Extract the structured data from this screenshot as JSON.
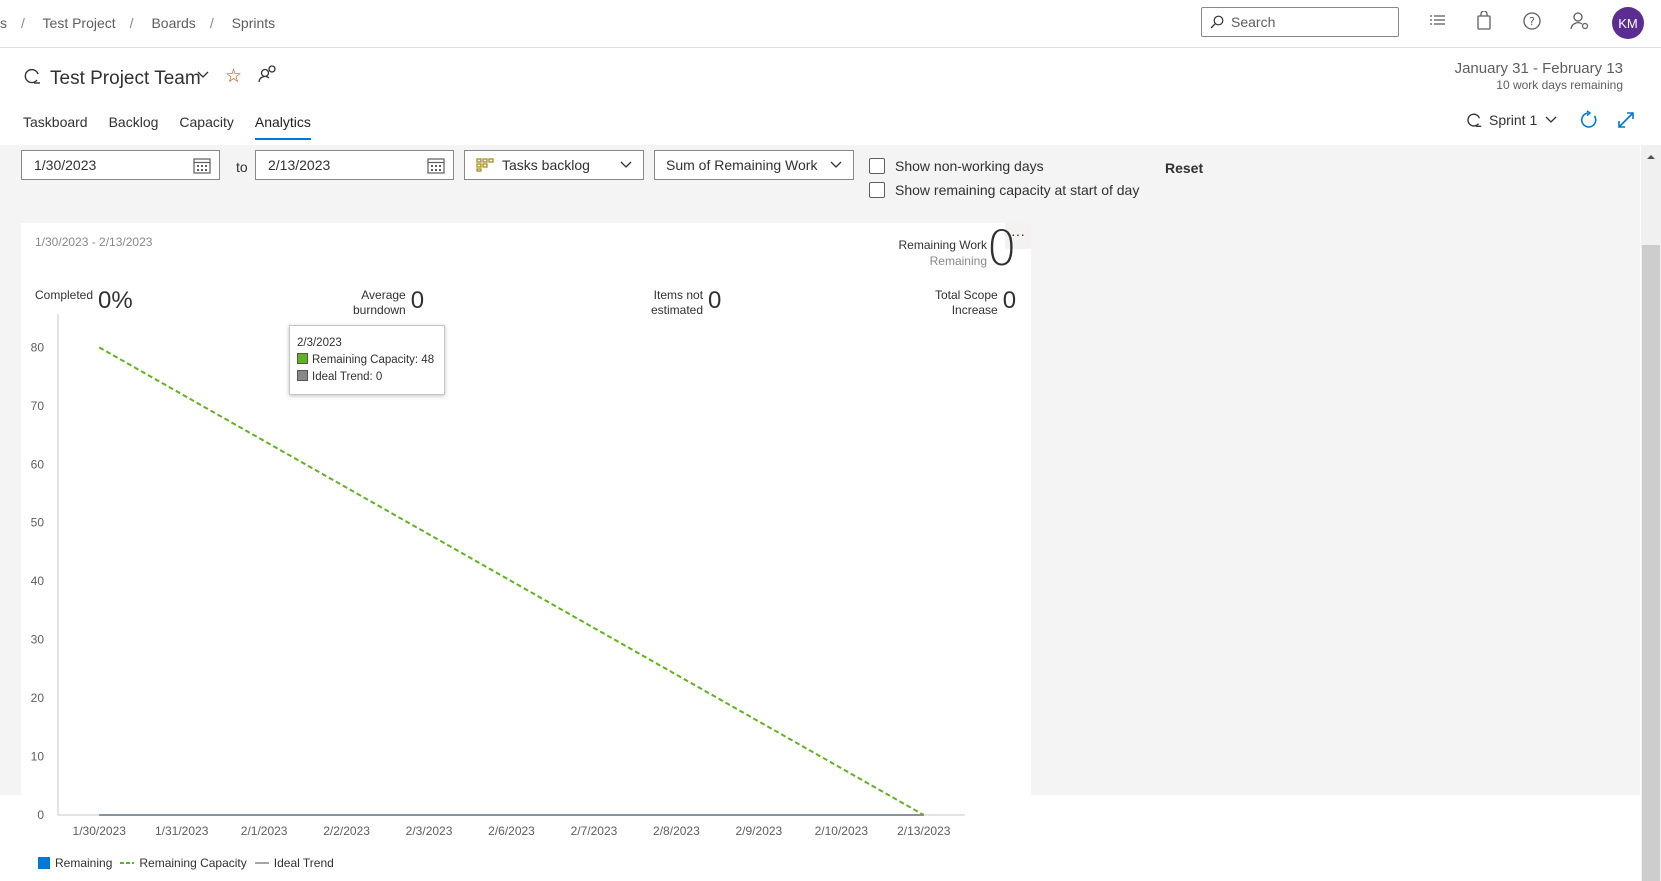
{
  "breadcrumb": {
    "items": [
      "s",
      "Test Project",
      "Boards",
      "Sprints"
    ],
    "sep": "/"
  },
  "search": {
    "placeholder": "Search"
  },
  "user": {
    "initials": "KM",
    "avatar_color": "#5c2d91"
  },
  "team": {
    "name": "Test Project Team"
  },
  "iteration": {
    "dates": "January 31 - February 13",
    "remaining": "10 work days remaining"
  },
  "tabs": [
    {
      "label": "Taskboard",
      "active": false
    },
    {
      "label": "Backlog",
      "active": false
    },
    {
      "label": "Capacity",
      "active": false
    },
    {
      "label": "Analytics",
      "active": true
    }
  ],
  "sprint": {
    "label": "Sprint 1"
  },
  "filters": {
    "start_date": "1/30/2023",
    "to_label": "to",
    "end_date": "2/13/2023",
    "backlog": "Tasks backlog",
    "metric": "Sum of Remaining Work",
    "show_nonworking": "Show non-working days",
    "show_capacity": "Show remaining capacity at start of day",
    "reset": "Reset"
  },
  "summary": {
    "date_range": "1/30/2023 - 2/13/2023",
    "remaining_work_label": "Remaining Work",
    "remaining_sub": "Remaining",
    "remaining_value": "0",
    "completed_label": "Completed",
    "completed_value": "0%",
    "avg_burndown_label_1": "Average",
    "avg_burndown_label_2": "burndown",
    "avg_burndown_value": "0",
    "not_estimated_label_1": "Items not",
    "not_estimated_label_2": "estimated",
    "not_estimated_value": "0",
    "scope_label_1": "Total Scope",
    "scope_label_2": "Increase",
    "scope_value": "0",
    "more": "···"
  },
  "tooltip": {
    "date": "2/3/2023",
    "line1": "Remaining Capacity: 48",
    "line2": "Ideal Trend: 0"
  },
  "colors": {
    "remaining": "#0078d4",
    "remaining_capacity": "#60b31e",
    "ideal_trend": "#8a8886",
    "accent": "#0078d4"
  },
  "chart_data": {
    "type": "line",
    "categories": [
      "1/30/2023",
      "1/31/2023",
      "2/1/2023",
      "2/2/2023",
      "2/3/2023",
      "2/6/2023",
      "2/7/2023",
      "2/8/2023",
      "2/9/2023",
      "2/10/2023",
      "2/13/2023"
    ],
    "series": [
      {
        "name": "Remaining",
        "values": [
          0,
          0,
          0,
          0,
          0,
          0,
          0,
          0,
          0,
          0,
          0
        ]
      },
      {
        "name": "Remaining Capacity",
        "values": [
          80,
          72,
          64,
          56,
          48,
          40,
          32,
          24,
          16,
          8,
          0
        ],
        "style": "dashed"
      },
      {
        "name": "Ideal Trend",
        "values": [
          0,
          0,
          0,
          0,
          0,
          0,
          0,
          0,
          0,
          0,
          0
        ]
      }
    ],
    "yticks": [
      0,
      10,
      20,
      30,
      40,
      50,
      60,
      70,
      80
    ],
    "ylim": [
      0,
      84
    ],
    "legend": "bottom-left",
    "grid": false
  }
}
